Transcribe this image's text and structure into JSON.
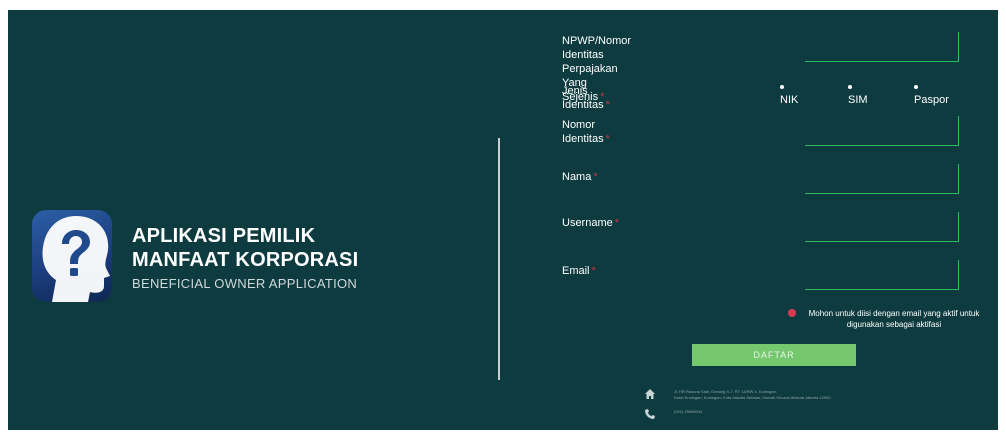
{
  "brand": {
    "line1": "APLIKASI PEMILIK",
    "line2": "MANFAAT KORPORASI",
    "subtitle": "BENEFICIAL OWNER APPLICATION",
    "logo_icon": "question-head-icon"
  },
  "form": {
    "npwp": {
      "label_line1": "NPWP/Nomor Identitas Perpajakan Yang",
      "label_line2": "Sejenis",
      "required_mark": "*",
      "value": ""
    },
    "jenis_identitas": {
      "label": "Jenis Identitas",
      "required_mark": "*",
      "options": [
        "NIK",
        "SIM",
        "Paspor"
      ]
    },
    "nomor_identitas": {
      "label": "Nomor Identitas",
      "required_mark": "*",
      "value": ""
    },
    "nama": {
      "label": "Nama",
      "required_mark": "*",
      "value": ""
    },
    "username": {
      "label": "Username",
      "required_mark": "*",
      "value": ""
    },
    "email": {
      "label": "Email",
      "required_mark": "*",
      "value": ""
    },
    "email_hint_line1": "Mohon untuk diisi dengan email yang aktif untuk",
    "email_hint_line2": "digunakan sebagai aktifasi",
    "submit_label": "DAFTAR"
  },
  "footer": {
    "address_line1": "Jl. HR Rasuna Said, Gedung X-7, RT 14/RW 4, Kuningan,",
    "address_line2": "Karet Kuningan, Kuningan, Kota Jakarta Selatan, Daerah Khusus Ibukota Jakarta 12940",
    "phone": "(021) 29808044",
    "address_icon": "home-icon",
    "phone_icon": "phone-icon"
  },
  "colors": {
    "panel_bg": "#0e3b3f",
    "field_border": "#2fbf5a",
    "button_bg": "#76c86f",
    "required": "#c2364a",
    "hint_icon": "#d83a52"
  }
}
